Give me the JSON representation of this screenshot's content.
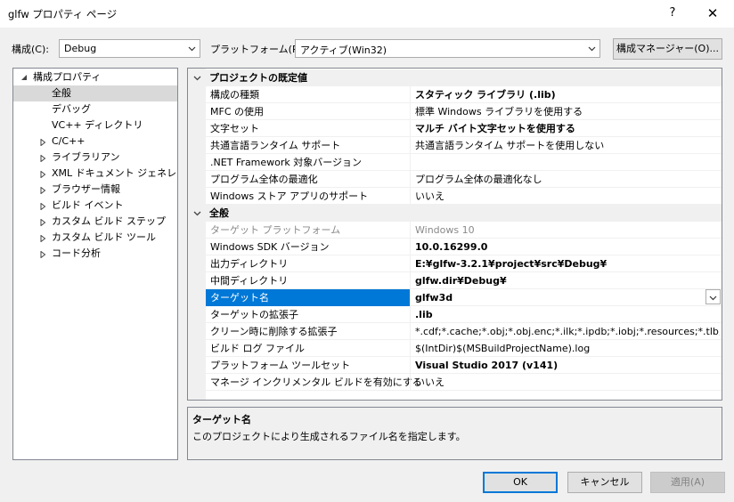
{
  "window": {
    "title": "glfw プロパティ ページ",
    "help_glyph": "?",
    "close_glyph": "✕"
  },
  "toolbar": {
    "config_label": "構成(C):",
    "config_value": "Debug",
    "platform_label": "プラットフォーム(P):",
    "platform_value": "アクティブ(Win32)",
    "config_manager_label": "構成マネージャー(O)..."
  },
  "tree": {
    "root": "構成プロパティ",
    "items": [
      {
        "label": "全般",
        "selected": true,
        "expandable": false
      },
      {
        "label": "デバッグ",
        "expandable": false
      },
      {
        "label": "VC++ ディレクトリ",
        "expandable": false
      },
      {
        "label": "C/C++",
        "expandable": true
      },
      {
        "label": "ライブラリアン",
        "expandable": true
      },
      {
        "label": "XML ドキュメント ジェネレーター",
        "expandable": true
      },
      {
        "label": "ブラウザー情報",
        "expandable": true
      },
      {
        "label": "ビルド イベント",
        "expandable": true
      },
      {
        "label": "カスタム ビルド ステップ",
        "expandable": true
      },
      {
        "label": "カスタム ビルド ツール",
        "expandable": true
      },
      {
        "label": "コード分析",
        "expandable": true
      }
    ]
  },
  "grid": {
    "categories": [
      {
        "name": "プロジェクトの既定値",
        "rows": [
          {
            "name": "構成の種類",
            "value": "スタティック ライブラリ (.lib)",
            "bold": true
          },
          {
            "name": "MFC の使用",
            "value": "標準 Windows ライブラリを使用する"
          },
          {
            "name": "文字セット",
            "value": "マルチ バイト文字セットを使用する",
            "bold": true
          },
          {
            "name": "共通言語ランタイム サポート",
            "value": "共通言語ランタイム サポートを使用しない"
          },
          {
            "name": ".NET Framework 対象バージョン",
            "value": ""
          },
          {
            "name": "プログラム全体の最適化",
            "value": "プログラム全体の最適化なし"
          },
          {
            "name": "Windows ストア アプリのサポート",
            "value": "いいえ"
          }
        ]
      },
      {
        "name": "全般",
        "rows": [
          {
            "name": "ターゲット プラットフォーム",
            "value": "Windows 10",
            "grey": true
          },
          {
            "name": "Windows SDK バージョン",
            "value": "10.0.16299.0",
            "bold": true
          },
          {
            "name": "出力ディレクトリ",
            "value": "E:¥glfw-3.2.1¥project¥src¥Debug¥",
            "bold": true
          },
          {
            "name": "中間ディレクトリ",
            "value": "glfw.dir¥Debug¥",
            "bold": true
          },
          {
            "name": "ターゲット名",
            "value": "glfw3d",
            "selected": true
          },
          {
            "name": "ターゲットの拡張子",
            "value": ".lib",
            "bold": true
          },
          {
            "name": "クリーン時に削除する拡張子",
            "value": "*.cdf;*.cache;*.obj;*.obj.enc;*.ilk;*.ipdb;*.iobj;*.resources;*.tlb;*.tli;*"
          },
          {
            "name": "ビルド ログ ファイル",
            "value": "$(IntDir)$(MSBuildProjectName).log"
          },
          {
            "name": "プラットフォーム ツールセット",
            "value": "Visual Studio 2017 (v141)",
            "bold": true
          },
          {
            "name": "マネージ インクリメンタル ビルドを有効にする",
            "value": "いいえ"
          }
        ]
      }
    ]
  },
  "description": {
    "title": "ターゲット名",
    "text": "このプロジェクトにより生成されるファイル名を指定します。"
  },
  "buttons": {
    "ok": "OK",
    "cancel": "キャンセル",
    "apply": "適用(A)"
  },
  "colors": {
    "selection": "#0078d7",
    "tree_selection": "#d9d9d9"
  }
}
